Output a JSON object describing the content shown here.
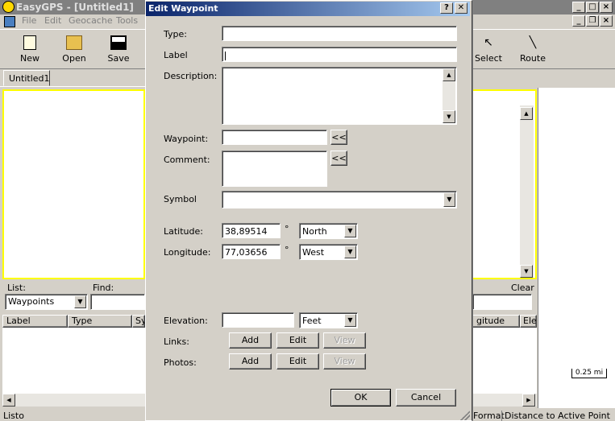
{
  "app": {
    "title": "EasyGPS - [Untitled1]",
    "menu": [
      "File",
      "Edit",
      "Geocache",
      "Tools"
    ],
    "toolbar": {
      "new_label": "New",
      "open_label": "Open",
      "save_label": "Save",
      "select_label": "Select",
      "route_label": "Route"
    },
    "doc_tab": "Untitled1",
    "list_label": "List:",
    "list_value": "Waypoints",
    "find_label": "Find:",
    "clear_label": "Clear",
    "columns": [
      "Label",
      "Type",
      "Sy",
      "gitude",
      "Ele"
    ],
    "scale": "0.25 mi",
    "status_left": "Listo",
    "status_format": "Format",
    "status_distance": "Distance to Active Point"
  },
  "dialog": {
    "title": "Edit Waypoint",
    "help_btn": "?",
    "close_btn": "✕",
    "type_label": "Type:",
    "type_value": "",
    "label_label": "Label",
    "label_value": "",
    "description_label": "Description:",
    "description_value": "",
    "waypoint_label": "Waypoint:",
    "waypoint_value": "",
    "comment_label": "Comment:",
    "comment_value": "",
    "copy_btn": "<<",
    "symbol_label": "Symbol",
    "symbol_value": "",
    "latitude_label": "Latitude:",
    "latitude_value": "38,89514",
    "latitude_dir": "North",
    "longitude_label": "Longitude:",
    "longitude_value": "77,03656",
    "longitude_dir": "West",
    "degree": "°",
    "elevation_label": "Elevation:",
    "elevation_value": "",
    "elevation_unit": "Feet",
    "links_label": "Links:",
    "photos_label": "Photos:",
    "add_label": "Add",
    "edit_label": "Edit",
    "view_label": "View",
    "ok_label": "OK",
    "cancel_label": "Cancel"
  }
}
